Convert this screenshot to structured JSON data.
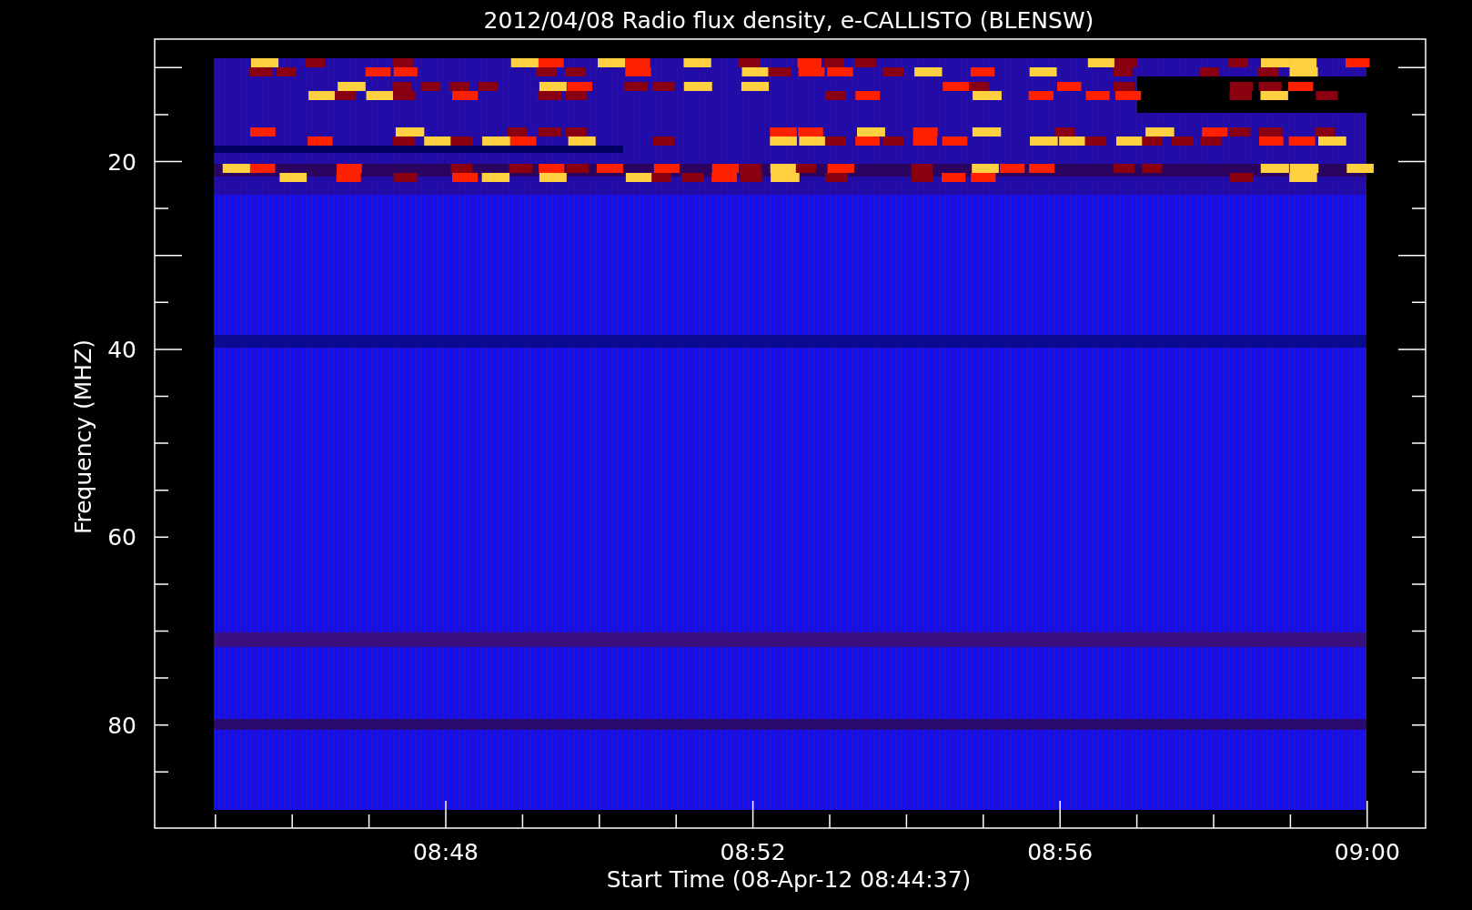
{
  "title": "2012/04/08  Radio flux density, e-CALLISTO (BLENSW)",
  "axes": {
    "xlabel": "Start Time (08-Apr-12 08:44:37)",
    "ylabel": "Frequency (MHZ)",
    "xticks": [
      "08:48",
      "08:52",
      "08:56",
      "09:00"
    ],
    "yticks": [
      "20",
      "40",
      "60",
      "80"
    ]
  }
}
